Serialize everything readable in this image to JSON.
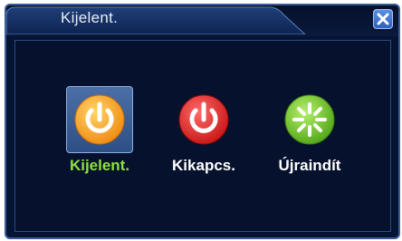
{
  "window": {
    "title": "Kijelent."
  },
  "actions": [
    {
      "label": "Kijelent.",
      "icon": "power-icon",
      "color": "#f5a623",
      "selected": true
    },
    {
      "label": "Kikapcs.",
      "icon": "shutdown-icon",
      "color": "#e02828",
      "selected": false
    },
    {
      "label": "Újraindít",
      "icon": "restart-icon",
      "color": "#6fc72a",
      "selected": false
    }
  ],
  "colors": {
    "background": "#061433",
    "border": "#3b5e97",
    "selected_label": "#8de23c"
  }
}
